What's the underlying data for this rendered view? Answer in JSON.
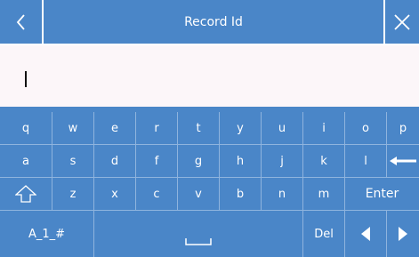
{
  "header": {
    "title": "Record Id",
    "back_icon": "chevron-left-icon",
    "close_icon": "close-icon"
  },
  "input": {
    "value": ""
  },
  "keyboard": {
    "row1": [
      "q",
      "w",
      "e",
      "r",
      "t",
      "y",
      "u",
      "i",
      "o",
      "p"
    ],
    "row2": [
      "a",
      "s",
      "d",
      "f",
      "g",
      "h",
      "j",
      "k",
      "l"
    ],
    "row3": [
      "z",
      "x",
      "c",
      "v",
      "b",
      "n",
      "m"
    ],
    "backspace_icon": "backspace-arrow-icon",
    "shift_icon": "shift-icon",
    "enter_label": "Enter",
    "mode_label": "A_1_#",
    "space_icon": "space-icon",
    "delete_label": "Del",
    "left_icon": "caret-left-icon",
    "right_icon": "caret-right-icon"
  },
  "colors": {
    "accent": "#4a86c8",
    "input_background": "#fcf6f9"
  }
}
